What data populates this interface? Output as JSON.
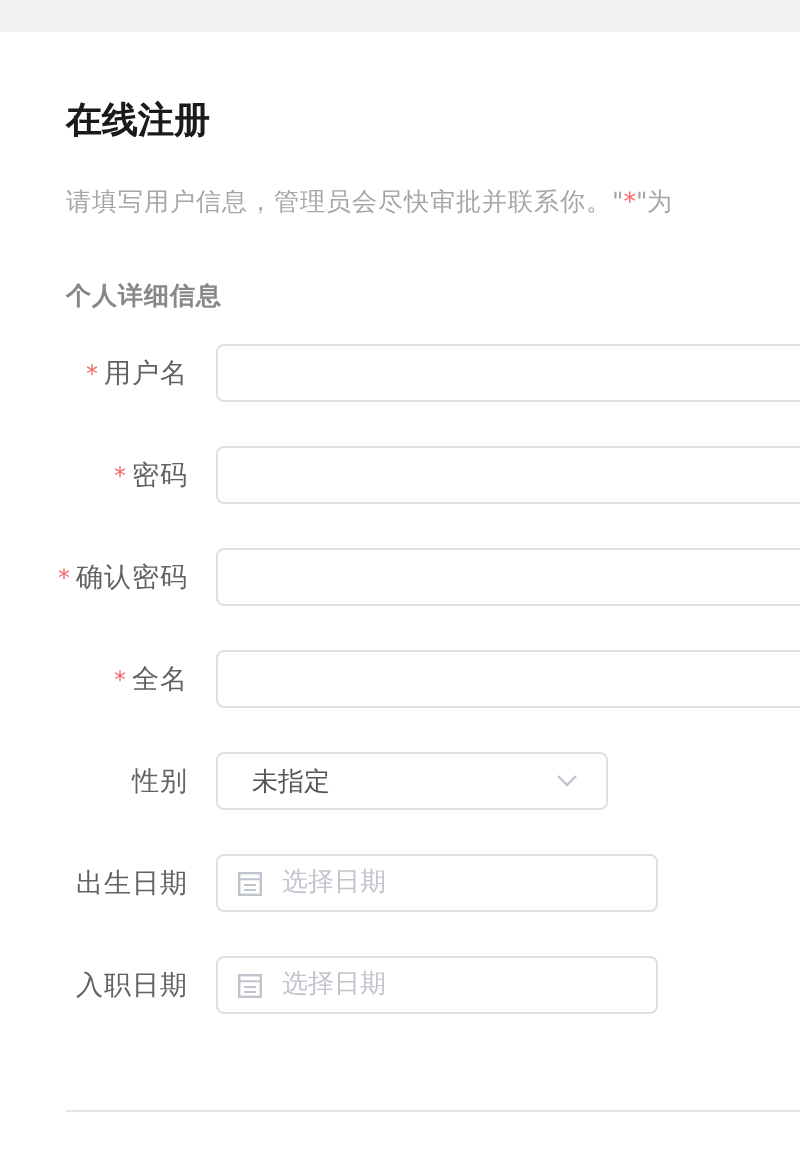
{
  "title": "在线注册",
  "subtitle": {
    "before": "请填写用户信息，管理员会尽快审批并联系你。\"",
    "mark": "*",
    "after": "\"为"
  },
  "section": "个人详细信息",
  "fields": [
    {
      "kind": "text",
      "label": "用户名",
      "required": true
    },
    {
      "kind": "text",
      "label": "密码",
      "required": true
    },
    {
      "kind": "text",
      "label": "确认密码",
      "required": true
    },
    {
      "kind": "text",
      "label": "全名",
      "required": true
    },
    {
      "kind": "select",
      "label": "性别",
      "required": false,
      "value": "未指定"
    },
    {
      "kind": "date",
      "label": "出生日期",
      "required": false,
      "placeholder": "选择日期"
    },
    {
      "kind": "date",
      "label": "入职日期",
      "required": false,
      "placeholder": "选择日期"
    }
  ]
}
